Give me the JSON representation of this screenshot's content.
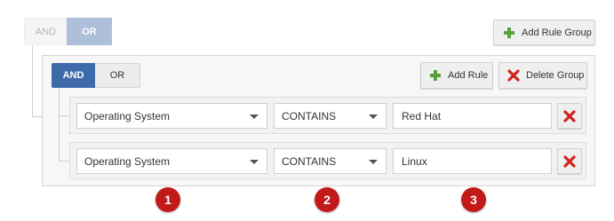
{
  "root": {
    "and_label": "AND",
    "or_label": "OR",
    "add_rule_group_label": "Add Rule Group"
  },
  "group": {
    "and_label": "AND",
    "or_label": "OR",
    "add_rule_label": "Add Rule",
    "delete_group_label": "Delete Group",
    "rules": [
      {
        "field": "Operating System",
        "operator": "CONTAINS",
        "value": "Red Hat"
      },
      {
        "field": "Operating System",
        "operator": "CONTAINS",
        "value": "Linux"
      }
    ]
  },
  "markers": [
    "1",
    "2",
    "3"
  ],
  "colors": {
    "selected_blue": "#3d6aaa",
    "selected_light_blue": "#aebfda",
    "add_green": "#5aa03c",
    "delete_red": "#d0241c",
    "marker_red": "#c21a1a"
  },
  "icons": {
    "add": "plus-icon",
    "delete": "x-icon",
    "dropdown": "caret-down-icon"
  }
}
